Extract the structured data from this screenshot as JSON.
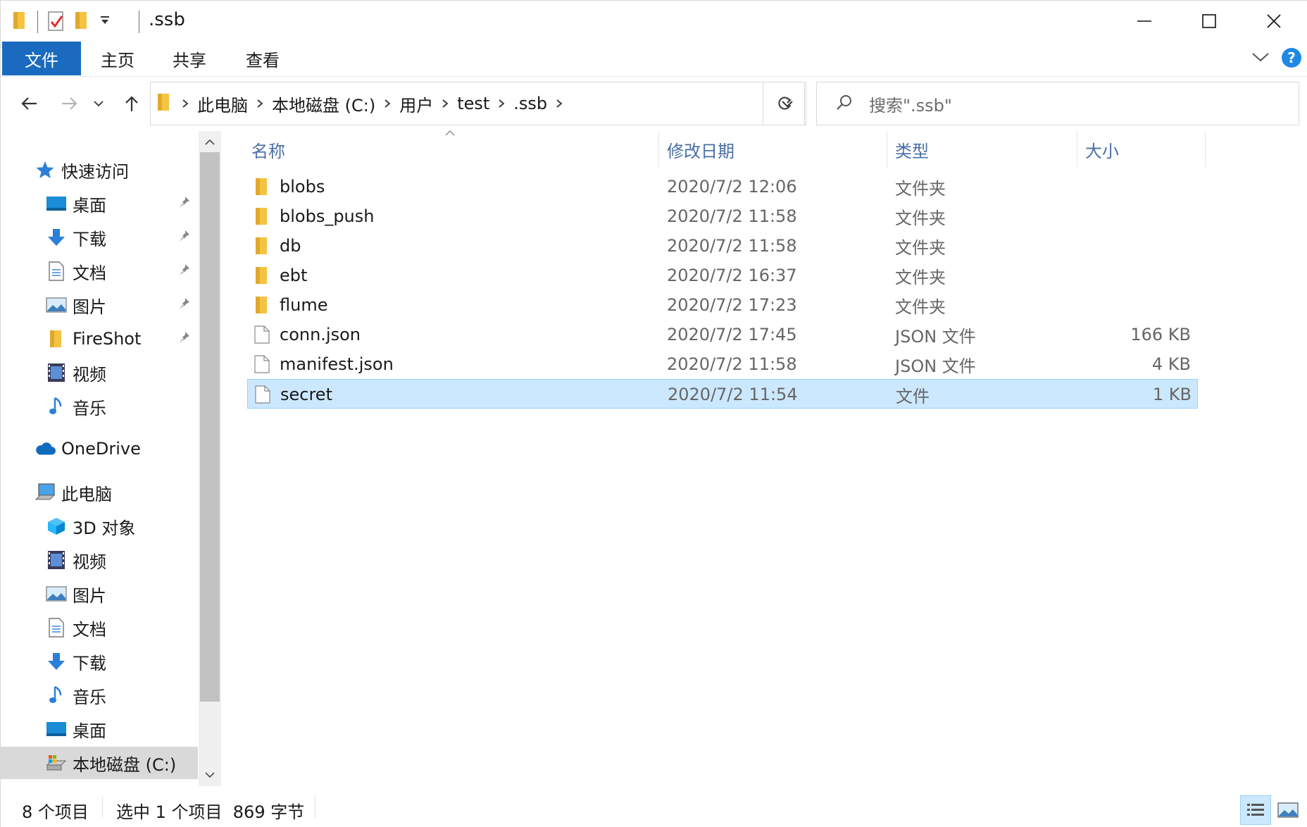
{
  "window": {
    "title": ".ssb",
    "colors": {
      "accent": "#1a6bbf",
      "selected_row": "#cce8ff",
      "folder": "#f5c342",
      "help": "#1e88e5"
    }
  },
  "ribbon": {
    "tabs": [
      {
        "label": "文件"
      },
      {
        "label": "主页"
      },
      {
        "label": "共享"
      },
      {
        "label": "查看"
      }
    ]
  },
  "address": {
    "crumbs": [
      "此电脑",
      "本地磁盘 (C:)",
      "用户",
      "test",
      ".ssb"
    ]
  },
  "search": {
    "placeholder": "搜索\".ssb\""
  },
  "sidebar": {
    "quick_access": "快速访问",
    "quick_items": [
      {
        "label": "桌面",
        "icon": "desktop-icon"
      },
      {
        "label": "下载",
        "icon": "download-icon"
      },
      {
        "label": "文档",
        "icon": "document-icon"
      },
      {
        "label": "图片",
        "icon": "picture-icon"
      },
      {
        "label": "FireShot",
        "icon": "folder-icon"
      },
      {
        "label": "视频",
        "icon": "video-icon"
      },
      {
        "label": "音乐",
        "icon": "music-icon"
      }
    ],
    "onedrive": "OneDrive",
    "this_pc": "此电脑",
    "pc_items": [
      {
        "label": "3D 对象",
        "icon": "3d-objects-icon"
      },
      {
        "label": "视频",
        "icon": "video-icon"
      },
      {
        "label": "图片",
        "icon": "picture-icon"
      },
      {
        "label": "文档",
        "icon": "document-icon"
      },
      {
        "label": "下载",
        "icon": "download-icon"
      },
      {
        "label": "音乐",
        "icon": "music-icon"
      },
      {
        "label": "桌面",
        "icon": "desktop-icon"
      },
      {
        "label": "本地磁盘 (C:)",
        "icon": "drive-icon"
      }
    ]
  },
  "filelist": {
    "columns": {
      "name": "名称",
      "modified": "修改日期",
      "type": "类型",
      "size": "大小"
    },
    "rows": [
      {
        "name": "blobs",
        "modified": "2020/7/2 12:06",
        "type": "文件夹",
        "size": "",
        "kind": "folder"
      },
      {
        "name": "blobs_push",
        "modified": "2020/7/2 11:58",
        "type": "文件夹",
        "size": "",
        "kind": "folder"
      },
      {
        "name": "db",
        "modified": "2020/7/2 11:58",
        "type": "文件夹",
        "size": "",
        "kind": "folder"
      },
      {
        "name": "ebt",
        "modified": "2020/7/2 16:37",
        "type": "文件夹",
        "size": "",
        "kind": "folder"
      },
      {
        "name": "flume",
        "modified": "2020/7/2 17:23",
        "type": "文件夹",
        "size": "",
        "kind": "folder"
      },
      {
        "name": "conn.json",
        "modified": "2020/7/2 17:45",
        "type": "JSON 文件",
        "size": "166 KB",
        "kind": "file"
      },
      {
        "name": "manifest.json",
        "modified": "2020/7/2 11:58",
        "type": "JSON 文件",
        "size": "4 KB",
        "kind": "file"
      },
      {
        "name": "secret",
        "modified": "2020/7/2 11:54",
        "type": "文件",
        "size": "1 KB",
        "kind": "file",
        "selected": true
      }
    ]
  },
  "status": {
    "count": "8 个项目",
    "selection": "选中 1 个项目  869 字节"
  }
}
